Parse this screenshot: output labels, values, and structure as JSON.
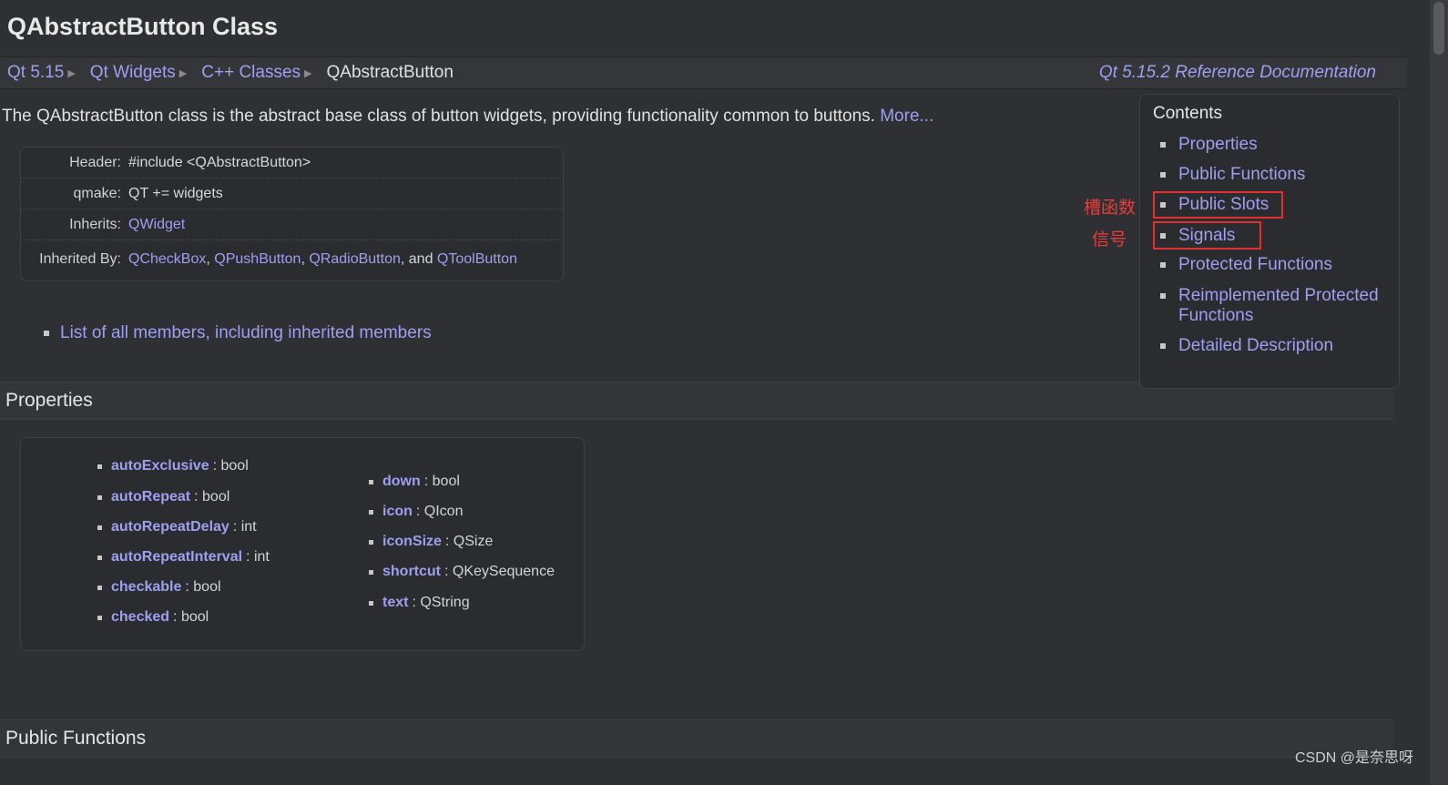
{
  "page": {
    "title": "QAbstractButton Class"
  },
  "breadcrumb": {
    "items": [
      "Qt 5.15",
      "Qt Widgets",
      "C++ Classes"
    ],
    "current": "QAbstractButton",
    "reference": "Qt 5.15.2 Reference Documentation"
  },
  "intro": {
    "text": "The QAbstractButton class is the abstract base class of button widgets, providing functionality common to buttons.",
    "more_link": "More..."
  },
  "info_table": {
    "header_label": "Header:",
    "header_value": "#include <QAbstractButton>",
    "qmake_label": "qmake:",
    "qmake_value": "QT += widgets",
    "inherits_label": "Inherits:",
    "inherits_value": "QWidget",
    "inherited_by_label": "Inherited By:",
    "inherited_by": [
      "QCheckBox",
      "QPushButton",
      "QRadioButton",
      "QToolButton"
    ],
    "inherited_sep1": ",",
    "inherited_sep2": ",",
    "inherited_and": ", and"
  },
  "members_link": "List of all members, including inherited members",
  "sections": {
    "properties": "Properties",
    "public_functions": "Public Functions"
  },
  "properties": {
    "left": [
      {
        "name": "autoExclusive",
        "type": ": bool"
      },
      {
        "name": "autoRepeat",
        "type": ": bool"
      },
      {
        "name": "autoRepeatDelay",
        "type": ": int"
      },
      {
        "name": "autoRepeatInterval",
        "type": ": int"
      },
      {
        "name": "checkable",
        "type": ": bool"
      },
      {
        "name": "checked",
        "type": ": bool"
      }
    ],
    "right": [
      {
        "name": "down",
        "type": ": bool"
      },
      {
        "name": "icon",
        "type": ": QIcon"
      },
      {
        "name": "iconSize",
        "type": ": QSize"
      },
      {
        "name": "shortcut",
        "type": ": QKeySequence"
      },
      {
        "name": "text",
        "type": ": QString"
      }
    ]
  },
  "toc": {
    "title": "Contents",
    "items": [
      "Properties",
      "Public Functions",
      "Public Slots",
      "Signals",
      "Protected Functions",
      "Reimplemented Protected",
      "Detailed Description"
    ],
    "item_5_line2": "Functions"
  },
  "annotations": {
    "slots_note": "槽函数",
    "signals_note": "信号",
    "highlight_color": "#e03030"
  },
  "watermark": "CSDN @是奈思呀",
  "colors": {
    "background": "#2f3033",
    "link": "#9f9ff0"
  }
}
